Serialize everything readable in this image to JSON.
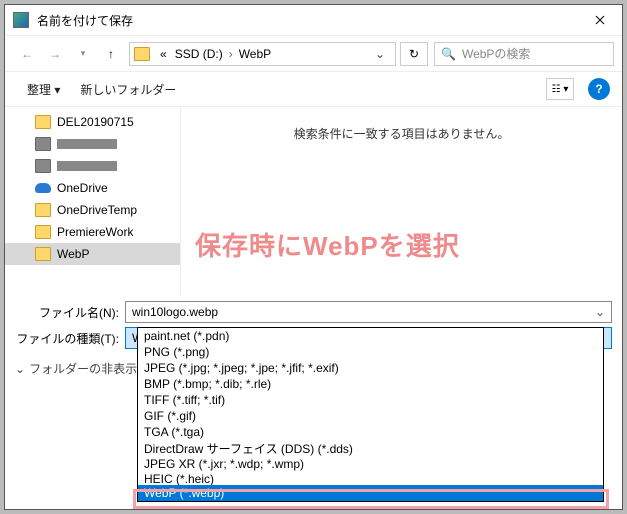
{
  "title": "名前を付けて保存",
  "breadcrumb": {
    "prefix": "«",
    "drive": "SSD (D:)",
    "sep": "›",
    "folder": "WebP"
  },
  "search": {
    "placeholder": "WebPの検索"
  },
  "toolbar": {
    "organize": "整理 ▾",
    "newfolder": "新しいフォルダー"
  },
  "tree": [
    {
      "label": "DEL20190715",
      "icon": "folder"
    },
    {
      "label": "",
      "icon": "redact",
      "redact": true
    },
    {
      "label": "",
      "icon": "redact",
      "redact": true
    },
    {
      "label": "OneDrive",
      "icon": "onedrive"
    },
    {
      "label": "OneDriveTemp",
      "icon": "folder"
    },
    {
      "label": "PremiereWork",
      "icon": "folder"
    },
    {
      "label": "WebP",
      "icon": "folder",
      "sel": true
    }
  ],
  "empty_msg": "検索条件に一致する項目はありません。",
  "annotation": "保存時にWebPを選択",
  "form": {
    "name_label": "ファイル名(N):",
    "name_value": "win10logo.webp",
    "type_label": "ファイルの種類(T):",
    "type_value": "WebP (*.webp)"
  },
  "options": [
    "paint.net (*.pdn)",
    "PNG (*.png)",
    "JPEG (*.jpg; *.jpeg; *.jpe; *.jfif; *.exif)",
    "BMP (*.bmp; *.dib; *.rle)",
    "TIFF (*.tiff; *.tif)",
    "GIF (*.gif)",
    "TGA (*.tga)",
    "DirectDraw サーフェイス (DDS) (*.dds)",
    "JPEG XR (*.jxr; *.wdp; *.wmp)",
    "HEIC (*.heic)",
    "WebP (*.webp)"
  ],
  "footer": "フォルダーの非表示"
}
